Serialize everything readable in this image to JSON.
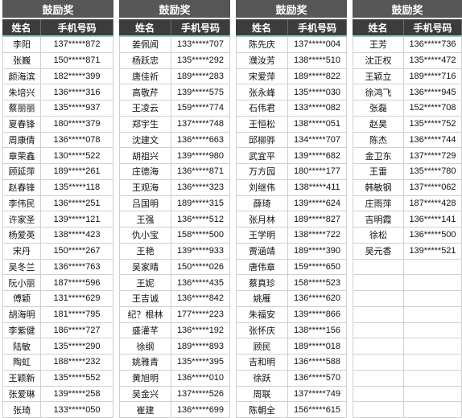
{
  "panels": [
    {
      "title": "鼓励奖",
      "headers": [
        "姓名",
        "手机号码"
      ],
      "rows": [
        [
          "李阳",
          "137*****872"
        ],
        [
          "张巍",
          "150*****871"
        ],
        [
          "颜海滨",
          "182*****399"
        ],
        [
          "朱培兴",
          "136*****316"
        ],
        [
          "蔡丽丽",
          "135*****937"
        ],
        [
          "夏春锋",
          "180*****379"
        ],
        [
          "周康倩",
          "136*****078"
        ],
        [
          "章荣鑫",
          "130*****522"
        ],
        [
          "顾延萍",
          "189*****261"
        ],
        [
          "赵春锋",
          "135*****118"
        ],
        [
          "李伟民",
          "136*****251"
        ],
        [
          "许家圣",
          "139*****121"
        ],
        [
          "杨爱英",
          "138*****423"
        ],
        [
          "宋丹",
          "150*****267"
        ],
        [
          "吴冬兰",
          "136*****763"
        ],
        [
          "阮小丽",
          "187*****596"
        ],
        [
          "傅颖",
          "131*****629"
        ],
        [
          "胡海明",
          "181*****795"
        ],
        [
          "李紫健",
          "186*****727"
        ],
        [
          "陆敏",
          "135*****290"
        ],
        [
          "陶虹",
          "188*****232"
        ],
        [
          "王颖新",
          "135*****552"
        ],
        [
          "张爱琳",
          "139*****258"
        ],
        [
          "张琦",
          "133*****050"
        ]
      ]
    },
    {
      "title": "鼓励奖",
      "headers": [
        "姓名",
        "手机号码"
      ],
      "rows": [
        [
          "姜佩闻",
          "133*****707"
        ],
        [
          "杨跃忠",
          "135*****292"
        ],
        [
          "唐佳祈",
          "189*****283"
        ],
        [
          "高敬芹",
          "139*****575"
        ],
        [
          "王凌云",
          "159*****774"
        ],
        [
          "郑宇生",
          "137*****748"
        ],
        [
          "沈建文",
          "136*****663"
        ],
        [
          "胡祖兴",
          "139*****980"
        ],
        [
          "庄德海",
          "136*****871"
        ],
        [
          "王观海",
          "136*****323"
        ],
        [
          "吕国明",
          "189*****315"
        ],
        [
          "王强",
          "136*****512"
        ],
        [
          "仇小宝",
          "158*****500"
        ],
        [
          "王艳",
          "139*****933"
        ],
        [
          "吴家晴",
          "150*****026"
        ],
        [
          "王妮",
          "136*****435"
        ],
        [
          "王吉诚",
          "136*****842"
        ],
        [
          "纪？根林",
          "177*****223"
        ],
        [
          "盛灌芊",
          "136*****192"
        ],
        [
          "徐纲",
          "189*****893"
        ],
        [
          "姚雅青",
          "135*****395"
        ],
        [
          "黄旭明",
          "136*****010"
        ],
        [
          "吴金兴",
          "137*****526"
        ],
        [
          "崔建",
          "136*****699"
        ]
      ]
    },
    {
      "title": "鼓励奖",
      "headers": [
        "姓名",
        "手机号码"
      ],
      "rows": [
        [
          "陈先庆",
          "137*****004"
        ],
        [
          "濮汝芳",
          "138*****510"
        ],
        [
          "宋爱萍",
          "189*****822"
        ],
        [
          "张永峰",
          "135*****030"
        ],
        [
          "石伟君",
          "133*****082"
        ],
        [
          "王恒松",
          "138*****051"
        ],
        [
          "邱柳骅",
          "134*****707"
        ],
        [
          "武宜平",
          "139*****682"
        ],
        [
          "万方园",
          "180*****177"
        ],
        [
          "刘继伟",
          "138*****411"
        ],
        [
          "薛琦",
          "139*****624"
        ],
        [
          "张月林",
          "189*****827"
        ],
        [
          "王学明",
          "138*****722"
        ],
        [
          "贾涵靖",
          "189*****390"
        ],
        [
          "唐伟章",
          "159*****650"
        ],
        [
          "蔡真珍",
          "158*****523"
        ],
        [
          "姚雁",
          "136*****620"
        ],
        [
          "朱福安",
          "139*****866"
        ],
        [
          "张怀庆",
          "138*****156"
        ],
        [
          "顾民",
          "189*****018"
        ],
        [
          "吉和明",
          "136*****588"
        ],
        [
          "徐跃",
          "136*****570"
        ],
        [
          "周联",
          "137*****749"
        ],
        [
          "陈朝全",
          "156*****615"
        ]
      ]
    },
    {
      "title": "鼓励奖",
      "headers": [
        "姓名",
        "手机号码"
      ],
      "rows": [
        [
          "王芳",
          "136*****736"
        ],
        [
          "沈正权",
          "135*****472"
        ],
        [
          "王颖立",
          "189*****716"
        ],
        [
          "徐鸿飞",
          "136*****945"
        ],
        [
          "张磊",
          "152*****708"
        ],
        [
          "赵昊",
          "135*****752"
        ],
        [
          "陈杰",
          "136*****744"
        ],
        [
          "金卫东",
          "137*****729"
        ],
        [
          "王雷",
          "135*****780"
        ],
        [
          "韩敏钢",
          "137*****062"
        ],
        [
          "庄雨萍",
          "187*****428"
        ],
        [
          "吉明霞",
          "136*****141"
        ],
        [
          "徐松",
          "136*****500"
        ],
        [
          "吴元香",
          "139*****521"
        ],
        [
          "",
          ""
        ],
        [
          "",
          ""
        ],
        [
          "",
          ""
        ],
        [
          "",
          ""
        ],
        [
          "",
          ""
        ],
        [
          "",
          ""
        ],
        [
          "",
          ""
        ],
        [
          "",
          ""
        ],
        [
          "",
          ""
        ],
        [
          "",
          ""
        ]
      ]
    }
  ]
}
